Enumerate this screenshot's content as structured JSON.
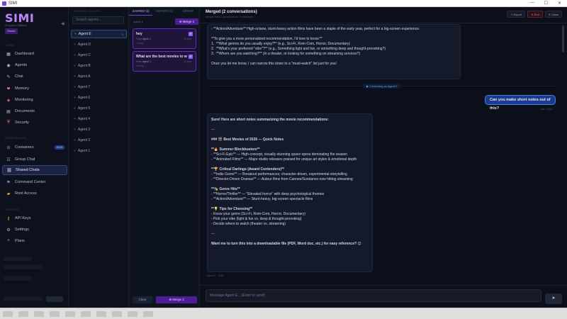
{
  "window": {
    "title": "SIMI",
    "controls": [
      "—",
      "☐",
      "✕"
    ]
  },
  "sidebar": {
    "logo": "SIMI",
    "logo_sub": "AI Agent Platform",
    "tier": "Owner",
    "sections": {
      "core": "CORE",
      "workspace": "WORKSPACE",
      "system": "SYSTEM"
    },
    "core_items": [
      {
        "label": "Dashboard",
        "icon": "grid-icon"
      },
      {
        "label": "Agents",
        "icon": "agents-icon"
      },
      {
        "label": "Chat",
        "icon": "chat-icon"
      },
      {
        "label": "Memory",
        "icon": "memory-icon"
      },
      {
        "label": "Monitoring",
        "icon": "monitoring-icon"
      },
      {
        "label": "Documents",
        "icon": "documents-icon"
      },
      {
        "label": "Security",
        "icon": "shield-icon"
      }
    ],
    "workspace_items": [
      {
        "label": "Containers",
        "icon": "containers-icon",
        "badge": "NEW"
      },
      {
        "label": "Group Chat",
        "icon": "group-chat-icon"
      },
      {
        "label": "Shared Chats",
        "icon": "link-icon"
      },
      {
        "label": "Command Center",
        "icon": "command-icon"
      },
      {
        "label": "Root Access",
        "icon": "folder-icon"
      }
    ],
    "system_items": [
      {
        "label": "API Keys",
        "icon": "key-icon"
      },
      {
        "label": "Settings",
        "icon": "gear-icon"
      },
      {
        "label": "Plans",
        "icon": "plus-icon"
      }
    ]
  },
  "chatlist": {
    "header": "SHARED CHATS",
    "search_placeholder": "Search agents...",
    "agents": [
      {
        "label": "Agent E",
        "count": "2",
        "active": true
      },
      {
        "label": "Agent D"
      },
      {
        "label": "Agent C"
      },
      {
        "label": "Agent B"
      },
      {
        "label": "Agent A"
      },
      {
        "label": "Agent 7"
      },
      {
        "label": "Agent 6"
      },
      {
        "label": "Agent 5"
      },
      {
        "label": "Agent 4"
      },
      {
        "label": "Agent 3"
      },
      {
        "label": "Agent 2"
      },
      {
        "label": "Agent 1"
      }
    ]
  },
  "convcol": {
    "tabs": [
      "SHARED (2)",
      "HISTORY (1)",
      "GROUP"
    ],
    "agent_label": "Agent 1",
    "merge_top": "⊕ Merge 2",
    "cards": [
      {
        "title": "hey",
        "meta_from": "From",
        "meta_agent": "Agent 1",
        "meta2": "1 msg",
        "time": "2h ago"
      },
      {
        "title": "What are the best movies to watch in 2026",
        "meta_from": "From",
        "meta_agent": "Agent 1",
        "meta2": "4 msgs",
        "time": "2h ago"
      }
    ],
    "clear": "Clear",
    "merge_bottom": "⊕ Merge 2"
  },
  "main": {
    "title": "Merged (2 conversations)",
    "subtitle": "Merged from 2 conversations · 6 messages",
    "export": "⇩ Export",
    "end": "✕ End",
    "close": "✕ Close",
    "prev_bubble": [
      "- **Action/Adventure** High-octane, stunt-heavy action films have been a staple of the early year, perfect for a big-screen experience.",
      "",
      "**To give you a more personalized recommendation, I'd love to know:**",
      "1.  **What genres do you usually enjoy?** (e.g., Sci-Fi, Rom-Com, Horror, Documentary)",
      "2.  **What's your preferred \"vibe\"?** (e.g., Something light and fun, or something deep and thought-provoking?)",
      "3.  **Where are you watching?** (In a theater, or looking for something on streaming services?)",
      "",
      "Once you let me know, I can narrow this down to a \"must-watch\" list just for you!"
    ],
    "continuing": "▶ Continuing as Agent E",
    "user_msg": "Can you make short notes out of this?",
    "user_time": "Just · 2026",
    "ai_reply": [
      "Sure! Here are short notes summarizing the movie recommendations:",
      "",
      "---",
      "",
      "### 🎬 Best Movies of 2026 — Quick Notes",
      "",
      "**🔥 Summer Blockbusters**",
      "- **Sci-Fi Epic** — High-concept, visually stunning space opera dominating the season",
      "- **Animated Films** — Major studio releases praised for unique art styles & emotional depth",
      "",
      "**🏆 Critical Darlings (Award Contenders)**",
      "- **Indie Gems** — Breakout performances; character-driven, experimental storytelling",
      "- **Director-Driven Dramas** — Auteur films from Cannes/Sundance now hitting streaming",
      "",
      "**🎭 Genre Hits**",
      "- **Horror/Thriller** — \"Elevated horror\" with deep psychological themes",
      "- **Action/Adventure** — Stunt-heavy, big-screen spectacle films",
      "",
      "**💡 Tips for Choosing**",
      "- Know your genre (Sci-Fi, Rom-Com, Horror, Documentary)",
      "- Pick your vibe (light & fun vs. deep & thought-provoking)",
      "- Decide where to watch (theater vs. streaming)",
      "",
      "---",
      "",
      "Want me to turn this into a downloadable file (PDF, Word doc, etc.) for easy reference? 😊"
    ],
    "ai_time": "Agent E · 2026",
    "input_placeholder": "Message Agent E... (Enter to send)",
    "send": "➤"
  }
}
